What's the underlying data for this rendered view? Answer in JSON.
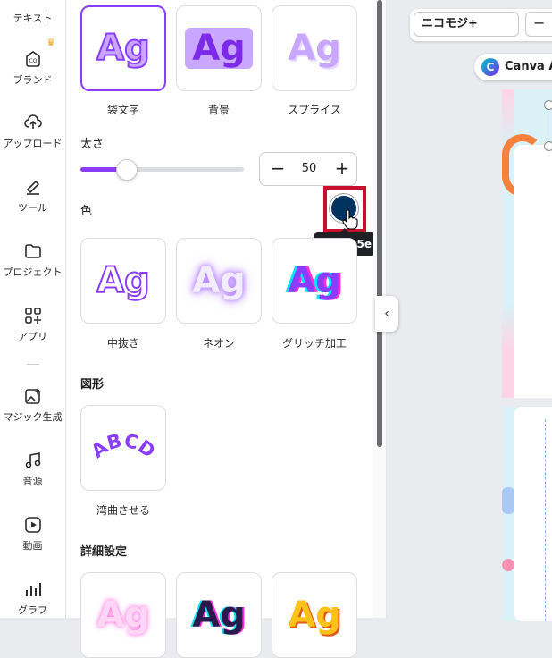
{
  "sidebar": {
    "items": [
      {
        "label": "テキスト",
        "icon": "text-icon"
      },
      {
        "label": "ブランド",
        "icon": "brand-icon"
      },
      {
        "label": "アップロード",
        "icon": "upload-cloud-icon"
      },
      {
        "label": "ツール",
        "icon": "draw-tool-icon"
      },
      {
        "label": "プロジェクト",
        "icon": "folder-icon"
      },
      {
        "label": "アプリ",
        "icon": "apps-icon"
      },
      {
        "label": "マジック生成",
        "icon": "magic-image-icon"
      },
      {
        "label": "音源",
        "icon": "music-note-icon"
      },
      {
        "label": "動画",
        "icon": "video-play-icon"
      },
      {
        "label": "グラフ",
        "icon": "bar-chart-icon"
      }
    ]
  },
  "effects": {
    "style_tiles": [
      {
        "label": "袋文字",
        "sample": "Ag",
        "selected": true
      },
      {
        "label": "背景",
        "sample": "Ag",
        "selected": false
      },
      {
        "label": "スプライス",
        "sample": "Ag",
        "selected": false
      }
    ],
    "thickness_label": "太さ",
    "thickness_value": "50",
    "thickness_percent": 28,
    "color_label": "色",
    "color_value": "#00345e",
    "color_tooltip": "#00345e",
    "style_tiles_2": [
      {
        "label": "中抜き",
        "sample": "Ag"
      },
      {
        "label": "ネオン",
        "sample": "Ag"
      },
      {
        "label": "グリッチ加工",
        "sample": "Ag"
      }
    ],
    "shape_title": "図形",
    "shape_tile": {
      "label": "湾曲させる",
      "sample": "ABCD"
    },
    "advanced_title": "詳細設定",
    "advanced_tiles": [
      {
        "sample": "Ag"
      },
      {
        "sample": "Ag"
      },
      {
        "sample": "Ag"
      }
    ]
  },
  "toolbar": {
    "font_name": "ニコモジ+",
    "size_minus": "−"
  },
  "canvas": {
    "chip_text": "Canva A",
    "logo_letter": "C"
  },
  "colors": {
    "accent": "#8b3dff",
    "highlight_box": "#c8102e",
    "swatch": "#00345e"
  }
}
